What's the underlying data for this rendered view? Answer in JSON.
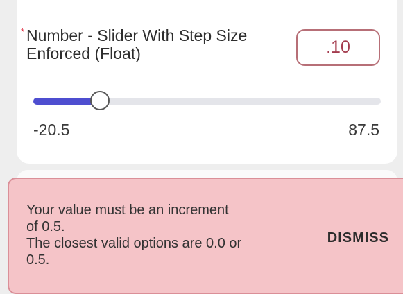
{
  "field": {
    "required_marker": "*",
    "label": "Number - Slider With Step Size Enforced (Float)",
    "value": ".10"
  },
  "slider": {
    "min_label": "-20.5",
    "max_label": "87.5",
    "min": -20.5,
    "max": 87.5,
    "value": 0.1
  },
  "toast": {
    "message_lines": [
      "Your value must be an increment",
      "of 0.5.",
      "The closest valid options are 0.0 or",
      "0.5."
    ],
    "action": "DISMISS"
  },
  "colors": {
    "accent": "#4e4ed0",
    "error_border": "#b76f77",
    "error_text": "#a43c4e",
    "toast_bg": "#f5c4c8",
    "required": "#e1374a"
  }
}
